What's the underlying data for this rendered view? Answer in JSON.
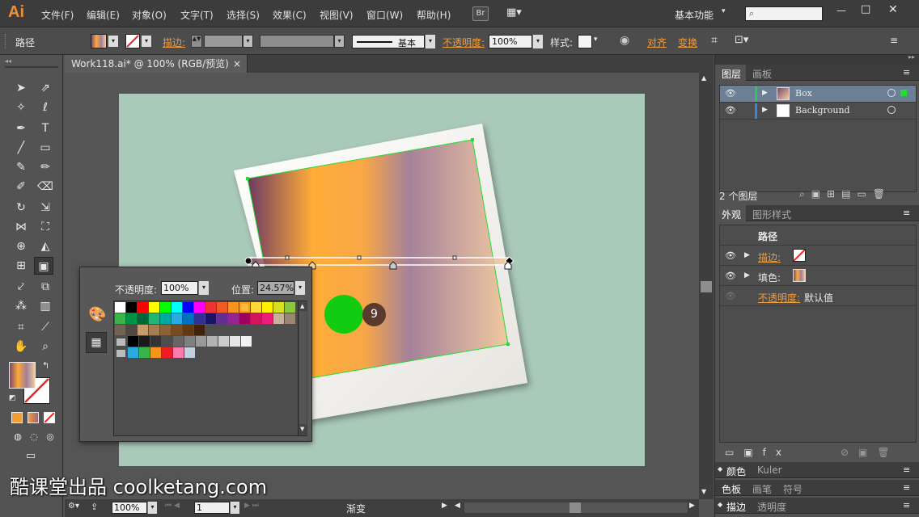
{
  "app": {
    "logo": "Ai",
    "menu": [
      "文件(F)",
      "编辑(E)",
      "对象(O)",
      "文字(T)",
      "选择(S)",
      "效果(C)",
      "视图(V)",
      "窗口(W)",
      "帮助(H)"
    ],
    "bridge_label": "Br",
    "workspace": "基本功能",
    "search_placeholder": ""
  },
  "controlbar": {
    "selection_type": "路径",
    "stroke_label": "描边:",
    "stroke_style": "基本",
    "opacity_label": "不透明度:",
    "opacity_value": "100%",
    "style_label": "样式:",
    "align_label": "对齐",
    "transform_label": "变换"
  },
  "document": {
    "tab_title": "Work118.ai* @ 100% (RGB/预览)",
    "zoom": "100%",
    "page": "1",
    "status_text": "渐变"
  },
  "layers_panel": {
    "tabs": [
      "图层",
      "画板"
    ],
    "layers": [
      {
        "name": "Box",
        "color": "#22cc55"
      },
      {
        "name": "Background",
        "color": "#3a86d6"
      }
    ],
    "count_label": "2 个图层"
  },
  "appearance_panel": {
    "tabs": [
      "外观",
      "图形样式"
    ],
    "title": "路径",
    "rows": [
      {
        "label": "描边:"
      },
      {
        "label": "填色:"
      },
      {
        "label": "不透明度:",
        "value": "默认值"
      }
    ]
  },
  "collapsed_panels": [
    {
      "tabs": [
        "颜色",
        "Kuler"
      ]
    },
    {
      "tabs": [
        "色板",
        "画笔",
        "符号"
      ]
    },
    {
      "tabs": [
        "描边",
        "透明度"
      ]
    }
  ],
  "gradient_popup": {
    "opacity_label": "不透明度:",
    "opacity_value": "100%",
    "position_label": "位置:",
    "position_value": "24.57%",
    "step_badge": "9"
  },
  "watermark": "酷课堂出品 coolketang.com",
  "colors": {
    "accent_orange": "#f39c3a",
    "artboard": "#a9c9b9",
    "selection_green": "#22dd33",
    "green_dot": "#11cc11"
  }
}
